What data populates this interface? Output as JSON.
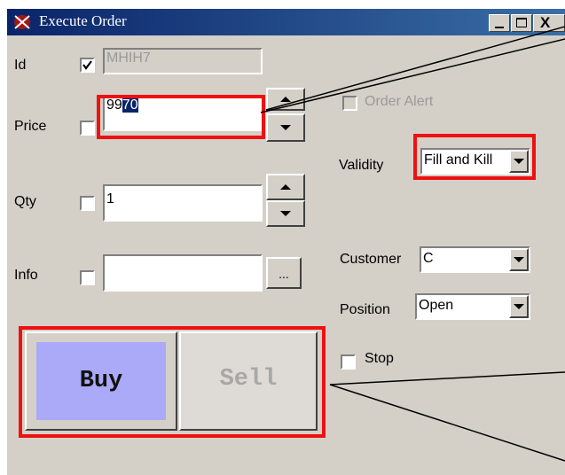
{
  "window": {
    "title": "Execute Order",
    "controls": {
      "minimize": "_",
      "maximize": "□",
      "close": "X"
    }
  },
  "fields": {
    "id": {
      "label": "Id",
      "value": "MHIH7",
      "checked": true
    },
    "price": {
      "label": "Price",
      "value_plain": "99",
      "value_selected": "70",
      "checked": false
    },
    "qty": {
      "label": "Qty",
      "value": "1",
      "checked": false
    },
    "info": {
      "label": "Info",
      "value": "",
      "browse_label": "...",
      "checked": false
    }
  },
  "options": {
    "order_alert": {
      "label": "Order Alert",
      "checked": false,
      "enabled": false
    },
    "validity": {
      "label": "Validity",
      "value": "Fill and Kill"
    },
    "customer": {
      "label": "Customer",
      "value": "C"
    },
    "position": {
      "label": "Position",
      "value": "Open"
    },
    "stop": {
      "label": "Stop",
      "checked": false
    }
  },
  "actions": {
    "buy": {
      "label": "Buy",
      "color": "#aaaaf8"
    },
    "sell": {
      "label": "Sell",
      "enabled": false
    }
  },
  "colors": {
    "highlight": "#ee1111",
    "title_bar": "#0a246a",
    "selection": "#0a246a"
  }
}
